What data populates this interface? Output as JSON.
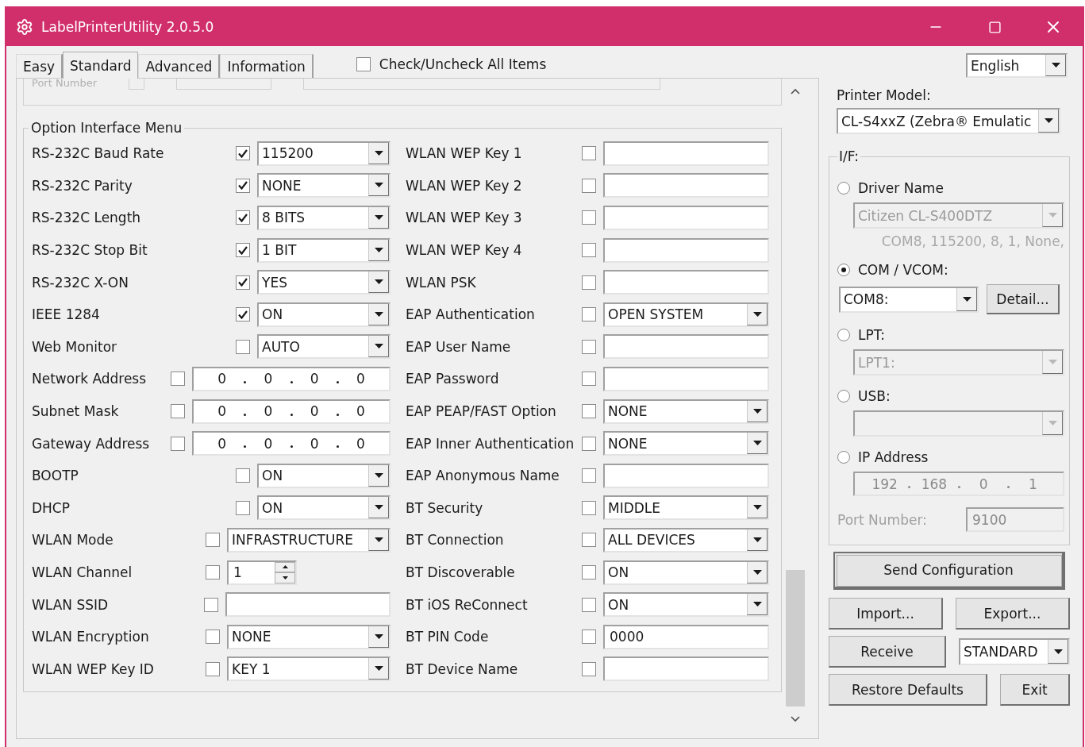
{
  "window": {
    "title": "LabelPrinterUtility 2.0.5.0"
  },
  "tabs": [
    {
      "label": "Easy",
      "selected": false
    },
    {
      "label": "Standard",
      "selected": true
    },
    {
      "label": "Advanced",
      "selected": false
    },
    {
      "label": "Information",
      "selected": false
    }
  ],
  "check_all": {
    "label": "Check/Uncheck All Items",
    "checked": false
  },
  "language": {
    "value": "English"
  },
  "cut_group": {
    "label": "Port Number"
  },
  "option_group": {
    "title": "Option Interface Menu",
    "left_rows": [
      {
        "kind": "combo",
        "label": "RS-232C Baud Rate",
        "checked": true,
        "value": "115200"
      },
      {
        "kind": "combo",
        "label": "RS-232C Parity",
        "checked": true,
        "value": "NONE"
      },
      {
        "kind": "combo",
        "label": "RS-232C Length",
        "checked": true,
        "value": "8 BITS"
      },
      {
        "kind": "combo",
        "label": "RS-232C Stop Bit",
        "checked": true,
        "value": "1 BIT"
      },
      {
        "kind": "combo",
        "label": "RS-232C X-ON",
        "checked": true,
        "value": "YES"
      },
      {
        "kind": "combo",
        "label": "IEEE 1284",
        "checked": true,
        "value": "ON"
      },
      {
        "kind": "combo",
        "label": "Web Monitor",
        "checked": false,
        "value": "AUTO"
      },
      {
        "kind": "ip",
        "label": "Network Address",
        "checked": false,
        "octets": [
          "0",
          "0",
          "0",
          "0"
        ]
      },
      {
        "kind": "ip",
        "label": "Subnet Mask",
        "checked": false,
        "octets": [
          "0",
          "0",
          "0",
          "0"
        ]
      },
      {
        "kind": "ip",
        "label": "Gateway Address",
        "checked": false,
        "octets": [
          "0",
          "0",
          "0",
          "0"
        ]
      },
      {
        "kind": "combo",
        "label": "BOOTP",
        "checked": false,
        "value": "ON"
      },
      {
        "kind": "combo",
        "label": "DHCP",
        "checked": false,
        "value": "ON"
      },
      {
        "kind": "wide_combo",
        "label": "WLAN Mode",
        "checked": false,
        "value": "INFRASTRUCTURE"
      },
      {
        "kind": "spin",
        "label": "WLAN Channel",
        "checked": false,
        "value": "1"
      },
      {
        "kind": "wide_text",
        "label": "WLAN SSID",
        "checked": false
      },
      {
        "kind": "wide_combo",
        "label": "WLAN Encryption",
        "checked": false,
        "value": "NONE"
      },
      {
        "kind": "wide_combo",
        "label": "WLAN WEP Key ID",
        "checked": false,
        "value": "KEY 1"
      }
    ],
    "right_rows": [
      {
        "kind": "text",
        "label": "WLAN WEP Key 1",
        "checked": false
      },
      {
        "kind": "text",
        "label": "WLAN WEP Key 2",
        "checked": false
      },
      {
        "kind": "text",
        "label": "WLAN WEP Key 3",
        "checked": false
      },
      {
        "kind": "text",
        "label": "WLAN WEP Key 4",
        "checked": false
      },
      {
        "kind": "text",
        "label": "WLAN PSK",
        "checked": false
      },
      {
        "kind": "combo",
        "label": "EAP Authentication",
        "checked": false,
        "value": "OPEN SYSTEM"
      },
      {
        "kind": "text",
        "label": "EAP User Name",
        "checked": false
      },
      {
        "kind": "text",
        "label": "EAP Password",
        "checked": false
      },
      {
        "kind": "combo",
        "label": "EAP PEAP/FAST Option",
        "checked": false,
        "value": "NONE"
      },
      {
        "kind": "combo",
        "label": "EAP Inner Authentication",
        "checked": false,
        "value": "NONE"
      },
      {
        "kind": "text",
        "label": "EAP Anonymous Name",
        "checked": false
      },
      {
        "kind": "combo",
        "label": "BT Security",
        "checked": false,
        "value": "MIDDLE"
      },
      {
        "kind": "combo",
        "label": "BT Connection",
        "checked": false,
        "value": "ALL DEVICES"
      },
      {
        "kind": "combo",
        "label": "BT Discoverable",
        "checked": false,
        "value": "ON"
      },
      {
        "kind": "combo",
        "label": "BT iOS ReConnect",
        "checked": false,
        "value": "ON"
      },
      {
        "kind": "text",
        "label": "BT PIN Code",
        "checked": false,
        "value": "0000"
      },
      {
        "kind": "text",
        "label": "BT Device Name",
        "checked": false
      }
    ]
  },
  "printer_model": {
    "label": "Printer Model:",
    "value": "CL-S4xxZ (Zebra® Emulatic"
  },
  "interface": {
    "title": "I/F:",
    "options": [
      {
        "kind": "combo",
        "label": "Driver Name",
        "selected": false,
        "value": "Citizen CL-S400DTZ",
        "disabled": true,
        "note": "COM8, 115200, 8, 1, None,"
      },
      {
        "kind": "combo_button",
        "label": "COM / VCOM:",
        "selected": true,
        "value": "COM8:",
        "disabled": false,
        "button": "Detail..."
      },
      {
        "kind": "combo",
        "label": "LPT:",
        "selected": false,
        "value": "LPT1:",
        "disabled": true
      },
      {
        "kind": "combo",
        "label": "USB:",
        "selected": false,
        "disabled": true
      },
      {
        "kind": "ip",
        "label": "IP Address",
        "selected": false,
        "octets": [
          "192",
          "168",
          "0",
          "1"
        ],
        "disabled": true,
        "port_label": "Port Number:",
        "port_value": "9100"
      }
    ]
  },
  "buttons": {
    "send": "Send Configuration",
    "import": "Import...",
    "export": "Export...",
    "receive": "Receive",
    "mode": "STANDARD",
    "restore": "Restore Defaults",
    "exit": "Exit"
  }
}
